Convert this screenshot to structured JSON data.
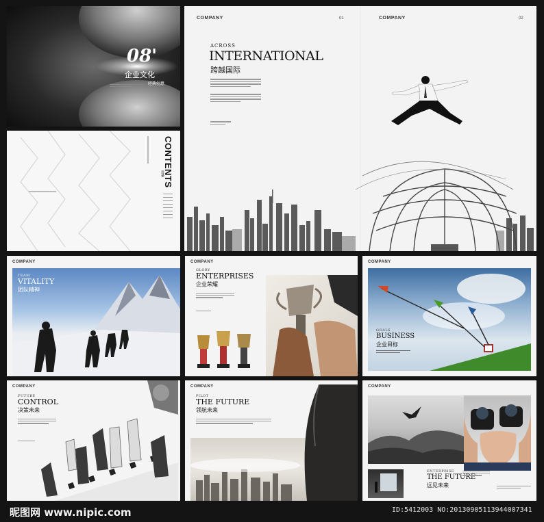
{
  "cover": {
    "number": "08'",
    "subtitle_cn": "企业文化",
    "tagline_cn": "经典创意"
  },
  "contents": {
    "title": "CONTENTS",
    "title_cn": "目录"
  },
  "spread": {
    "header_left": "COMPANY",
    "page_left": "01",
    "header_right": "COMPANY",
    "page_right": "02",
    "kicker": "ACROSS",
    "title": "INTERNATIONAL",
    "title_cn": "跨越国际"
  },
  "pages": [
    {
      "header": "COMPANY",
      "kicker": "TEAM",
      "title": "VITALITY",
      "title_cn": "团队精神"
    },
    {
      "header": "COMPANY",
      "kicker": "GLORY",
      "title": "ENTERPRISES",
      "title_cn": "企业荣耀"
    },
    {
      "header": "COMPANY",
      "kicker": "GOALS",
      "title": "BUSINESS",
      "title_cn": "企业目标"
    },
    {
      "header": "COMPANY",
      "kicker": "FUTURE",
      "title": "CONTROL",
      "title_cn": "决策未来"
    },
    {
      "header": "COMPANY",
      "kicker": "PILOT",
      "title": "THE FUTURE",
      "title_cn": "领航未来"
    },
    {
      "header": "COMPANY",
      "kicker": "ENTERPRISE",
      "title": "THE FUTURE",
      "title_cn": "远见未来"
    }
  ],
  "watermark": {
    "logo": "昵图网 www.nipic.com",
    "id": "ID:5412003 NO:20130905113944007341"
  }
}
